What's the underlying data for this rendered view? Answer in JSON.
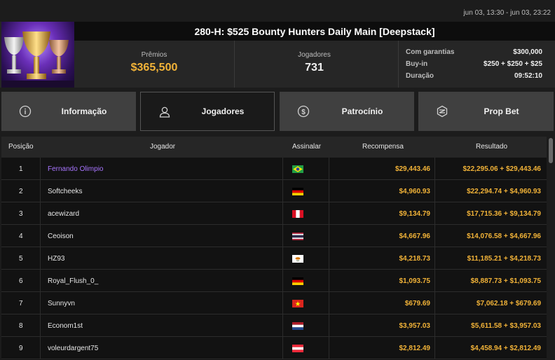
{
  "header": {
    "dates": "jun 03, 13:30 - jun 03, 23:22",
    "title": "280-H: $525 Bounty Hunters Daily Main [Deepstack]",
    "premios_label": "Prêmios",
    "premios_value": "$365,500",
    "jogadores_label": "Jogadores",
    "jogadores_value": "731",
    "info": [
      {
        "label": "Com garantias",
        "value": "$300,000"
      },
      {
        "label": "Buy-in",
        "value": "$250 + $250 + $25"
      },
      {
        "label": "Duração",
        "value": "09:52:10"
      }
    ]
  },
  "tabs": [
    {
      "label": "Informação",
      "icon": "info-icon",
      "active": false
    },
    {
      "label": "Jogadores",
      "icon": "user-icon",
      "active": true
    },
    {
      "label": "Patrocínio",
      "icon": "coin-icon",
      "active": false
    },
    {
      "label": "Prop Bet",
      "icon": "chip-icon",
      "active": false
    }
  ],
  "table": {
    "columns": [
      "Posição",
      "Jogador",
      "Assinalar",
      "Recompensa",
      "Resultado"
    ],
    "rows": [
      {
        "pos": "1",
        "name": "Fernando Olimpio",
        "flag": "brazil",
        "reward": "$29,443.46",
        "result": "$22,295.06 + $29,443.46"
      },
      {
        "pos": "2",
        "name": "Softcheeks",
        "flag": "germany",
        "reward": "$4,960.93",
        "result": "$22,294.74 + $4,960.93"
      },
      {
        "pos": "3",
        "name": "acewizard",
        "flag": "peru",
        "reward": "$9,134.79",
        "result": "$17,715.36 + $9,134.79"
      },
      {
        "pos": "4",
        "name": "Ceoison",
        "flag": "thailand",
        "reward": "$4,667.96",
        "result": "$14,076.58 + $4,667.96"
      },
      {
        "pos": "5",
        "name": "HZ93",
        "flag": "cyprus",
        "reward": "$4,218.73",
        "result": "$11,185.21 + $4,218.73"
      },
      {
        "pos": "6",
        "name": "Royal_Flush_0_",
        "flag": "germany",
        "reward": "$1,093.75",
        "result": "$8,887.73 + $1,093.75"
      },
      {
        "pos": "7",
        "name": "Sunnyvn",
        "flag": "vietnam",
        "reward": "$679.69",
        "result": "$7,062.18 + $679.69"
      },
      {
        "pos": "8",
        "name": "Econom1st",
        "flag": "netherlands",
        "reward": "$3,957.03",
        "result": "$5,611.58 + $3,957.03"
      },
      {
        "pos": "9",
        "name": "voleurdargent75",
        "flag": "austria",
        "reward": "$2,812.49",
        "result": "$4,458.94 + $2,812.49"
      }
    ]
  },
  "colors": {
    "gold": "#f2b338",
    "highlight_player": "#a875ff",
    "background": "#1c1c1c"
  }
}
